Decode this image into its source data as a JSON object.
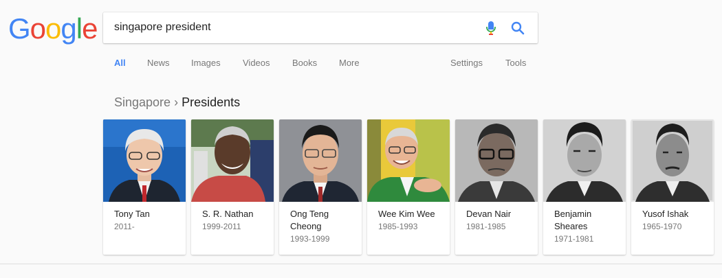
{
  "logo": {
    "letters": [
      {
        "char": "G",
        "color": "#4285F4"
      },
      {
        "char": "o",
        "color": "#EA4335"
      },
      {
        "char": "o",
        "color": "#FBBC05"
      },
      {
        "char": "g",
        "color": "#4285F4"
      },
      {
        "char": "l",
        "color": "#34A853"
      },
      {
        "char": "e",
        "color": "#EA4335"
      }
    ]
  },
  "search": {
    "query": "singapore president",
    "mic_icon": "mic-icon",
    "search_icon": "search-icon"
  },
  "tabs": [
    {
      "label": "All",
      "active": true
    },
    {
      "label": "News"
    },
    {
      "label": "Images"
    },
    {
      "label": "Videos"
    },
    {
      "label": "Books"
    },
    {
      "label": "More"
    }
  ],
  "tools": {
    "settings": "Settings",
    "tools": "Tools"
  },
  "breadcrumb": {
    "parent": "Singapore",
    "separator": "›",
    "current": "Presidents"
  },
  "presidents": [
    {
      "name": "Tony Tan",
      "years": "2011-"
    },
    {
      "name": "S. R. Nathan",
      "years": "1999-2011"
    },
    {
      "name": "Ong Teng Cheong",
      "years": "1993-1999"
    },
    {
      "name": "Wee Kim Wee",
      "years": "1985-1993"
    },
    {
      "name": "Devan Nair",
      "years": "1981-1985"
    },
    {
      "name": "Benjamin Sheares",
      "years": "1971-1981"
    },
    {
      "name": "Yusof Ishak",
      "years": "1965-1970"
    }
  ],
  "colors": {
    "accent": "#4285f4",
    "muted": "#777777"
  }
}
